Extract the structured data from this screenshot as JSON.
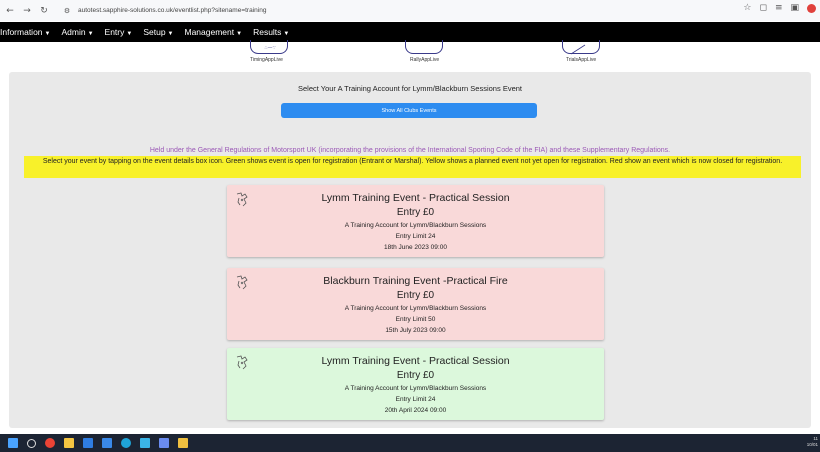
{
  "browser": {
    "url": "autotest.sapphire-solutions.co.uk/eventlist.php?sitename=training",
    "back_icon": "back-arrow-icon",
    "forward_icon": "forward-arrow-icon",
    "reload_icon": "reload-icon"
  },
  "menu": {
    "items": [
      {
        "label": "Information"
      },
      {
        "label": "Admin"
      },
      {
        "label": "Entry"
      },
      {
        "label": "Setup"
      },
      {
        "label": "Management"
      },
      {
        "label": "Results"
      }
    ]
  },
  "apps": [
    {
      "label": "TimingAppLive"
    },
    {
      "label": "RallyAppLive"
    },
    {
      "label": "TrialsAppLive"
    }
  ],
  "panel": {
    "title": "Select Your A Training Account for Lymm/Blackburn Sessions Event",
    "show_all_label": "Show All Clubs Events",
    "regulations": "Held under the General Regulations of Motorsport UK (incorporating the provisions of the International Sporting Code of the FIA) and these Supplementary Regulations.",
    "instruction": "Select your event by tapping on the event details box icon. Green shows event is open for registration (Entrant or Marshal). Yellow shows a planned event not yet open for registration. Red show an event which is now closed for registration."
  },
  "events": [
    {
      "title": "Lymm Training Event - Practical Session",
      "entry": "Entry £0",
      "club": "A Training Account for Lymm/Blackburn Sessions",
      "limit": "Entry Limit 24",
      "date": "18th June 2023  09:00",
      "status": "closed"
    },
    {
      "title": "Blackburn Training Event -Practical Fire",
      "entry": "Entry £0",
      "club": "A Training Account for Lymm/Blackburn Sessions",
      "limit": "Entry Limit 50",
      "date": "15th July 2023  09:00",
      "status": "closed"
    },
    {
      "title": "Lymm Training Event - Practical Session",
      "entry": "Entry £0",
      "club": "A Training Account for Lymm/Blackburn Sessions",
      "limit": "Entry Limit 24",
      "date": "20th April 2024  09:00",
      "status": "open"
    }
  ],
  "taskbar": {
    "clock_time": "11",
    "clock_date": "10/01"
  },
  "colors": {
    "closed": "#f9d9d9",
    "open": "#dcf8dc",
    "planned": "#f8f12a",
    "accent": "#2d8cf0"
  }
}
